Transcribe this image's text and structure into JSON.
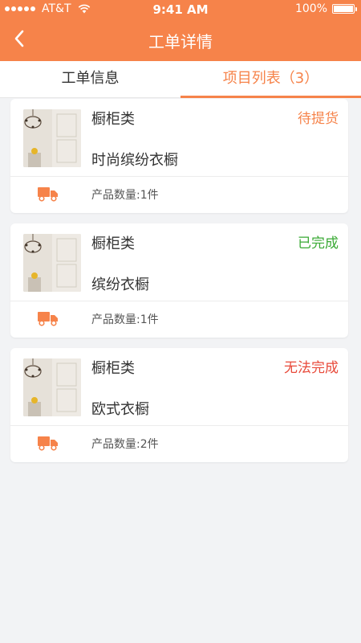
{
  "status_bar": {
    "carrier": "AT&T",
    "time": "9:41 AM",
    "battery": "100%"
  },
  "nav": {
    "title": "工单详情",
    "back_icon": "chevron-left-icon"
  },
  "tabs": [
    {
      "label": "工单信息",
      "active": false
    },
    {
      "label": "项目列表（3）",
      "active": true
    }
  ],
  "items": [
    {
      "category": "橱柜类",
      "name": "时尚缤纷衣橱",
      "status": "待提货",
      "status_type": "pending",
      "qty": "产品数量:1件"
    },
    {
      "category": "橱柜类",
      "name": "缤纷衣橱",
      "status": "已完成",
      "status_type": "done",
      "qty": "产品数量:1件"
    },
    {
      "category": "橱柜类",
      "name": "欧式衣橱",
      "status": "无法完成",
      "status_type": "failed",
      "qty": "产品数量:2件"
    }
  ],
  "colors": {
    "brand": "#f6834a",
    "done": "#3aaa35",
    "failed": "#e84a3a",
    "background": "#f2f3f5"
  }
}
